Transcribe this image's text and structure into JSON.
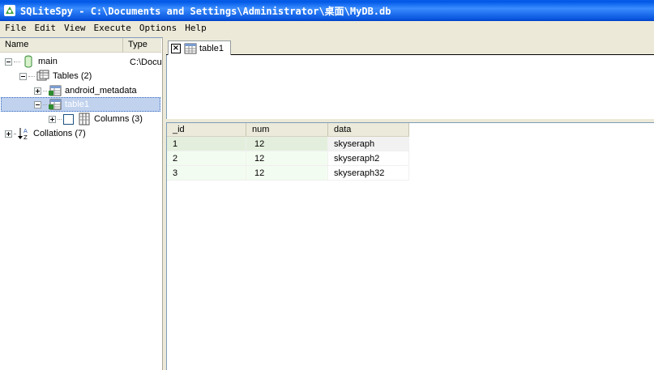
{
  "window": {
    "title": "SQLiteSpy - C:\\Documents and Settings\\Administrator\\桌面\\MyDB.db"
  },
  "menu": [
    "File",
    "Edit",
    "View",
    "Execute",
    "Options",
    "Help"
  ],
  "tree": {
    "headers": {
      "name": "Name",
      "type": "Type"
    },
    "nodes": {
      "main": {
        "label": "main",
        "type": "C:\\Documents and Settings\\Administrator\\桌面\\MyDB.db",
        "icon": "database-icon"
      },
      "tables": {
        "label": "Tables (2)",
        "icon": "tables-icon"
      },
      "android_metadata": {
        "label": "android_metadata",
        "icon": "table-icon"
      },
      "table1": {
        "label": "table1",
        "icon": "table-icon",
        "selected": true
      },
      "columns": {
        "label": "Columns (3)",
        "icon": "columns-icon"
      },
      "collations": {
        "label": "Collations (7)",
        "icon": "sort-az-icon"
      }
    }
  },
  "tabs": [
    {
      "label": "table1",
      "icon": "table-icon"
    }
  ],
  "results": {
    "columns": [
      "_id",
      "num",
      "data"
    ],
    "rows": [
      [
        "1",
        "12",
        "skyseraph"
      ],
      [
        "2",
        "12",
        "skyseraph2"
      ],
      [
        "3",
        "12",
        "skyseraph32"
      ]
    ]
  },
  "colors": {
    "titlebar": "#0a58e0",
    "selection": "#c1d2ee",
    "row_highlight": "#e3efdc"
  }
}
